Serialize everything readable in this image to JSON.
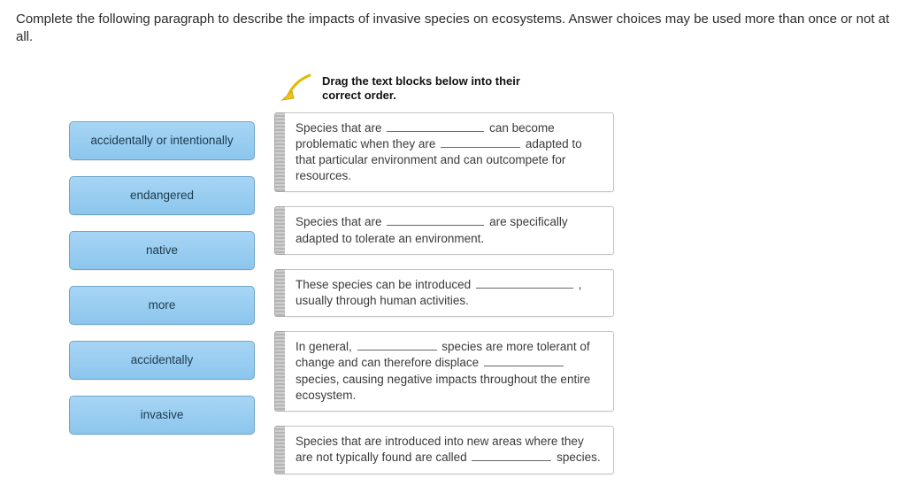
{
  "instructions": "Complete the following paragraph to describe the impacts of invasive species on ecosystems. Answer choices may be used more than once or not at all.",
  "hint": {
    "line1": "Drag the text blocks below into their",
    "line2": "correct order."
  },
  "choices": [
    {
      "label": "accidentally or intentionally"
    },
    {
      "label": "endangered"
    },
    {
      "label": "native"
    },
    {
      "label": "more"
    },
    {
      "label": "accidentally"
    },
    {
      "label": "invasive"
    }
  ],
  "blocks": {
    "b0": {
      "t0": "Species that are ",
      "t1": " can become problematic when they are ",
      "t2": " adapted to that particular environment and can outcompete for resources."
    },
    "b1": {
      "t0": "Species that are ",
      "t1": " are specifically adapted to tolerate an environment."
    },
    "b2": {
      "t0": "These species can be introduced ",
      "t1": " , usually through human activities."
    },
    "b3": {
      "t0": "In general, ",
      "t1": " species are more tolerant of change and can therefore displace ",
      "t2": " species, causing negative impacts throughout the entire ecosystem."
    },
    "b4": {
      "t0": "Species that are introduced into new areas where they are not typically found are called ",
      "t1": " species."
    }
  }
}
